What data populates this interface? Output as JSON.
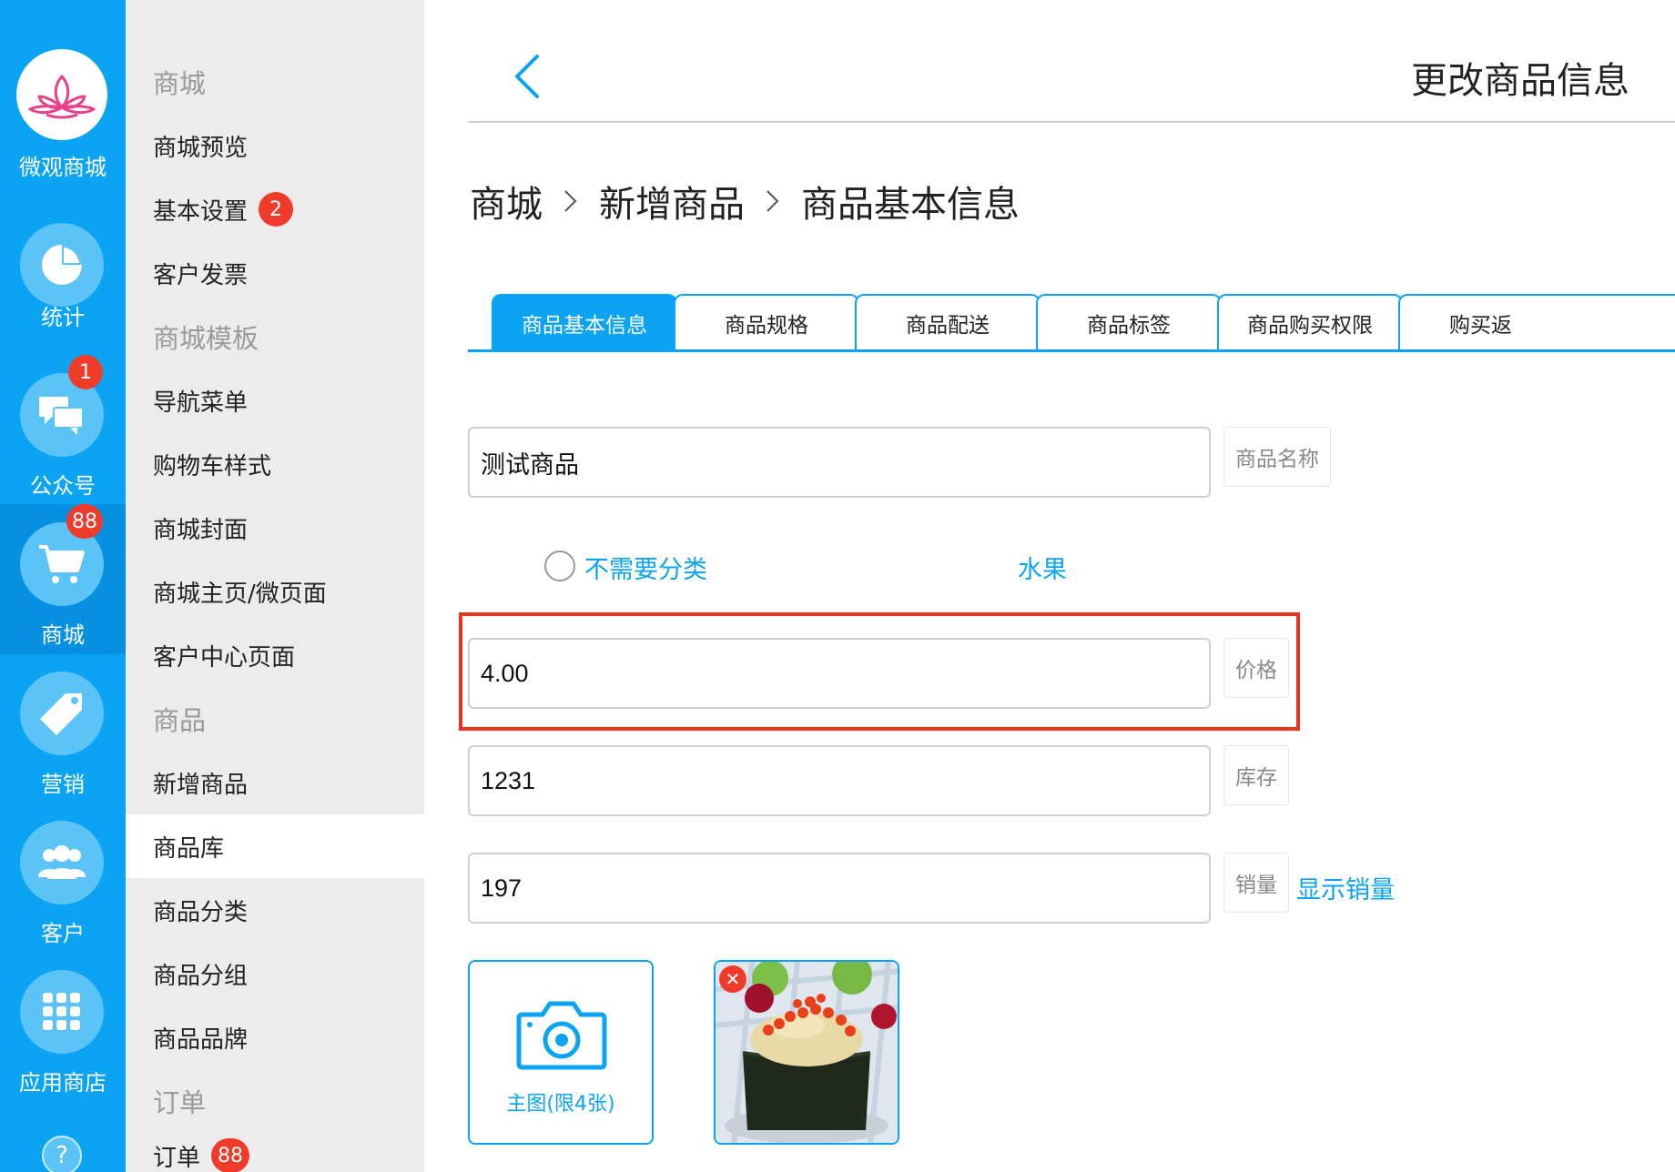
{
  "rail": {
    "logo_label": "微观商城",
    "items": [
      {
        "label": "统计",
        "icon": "pie-chart-icon"
      },
      {
        "label": "公众号",
        "icon": "chat-bubbles-icon",
        "badge": "1"
      },
      {
        "label": "商城",
        "icon": "shopping-cart-icon",
        "badge": "88",
        "active": true
      },
      {
        "label": "营销",
        "icon": "tag-icon"
      },
      {
        "label": "客户",
        "icon": "users-icon"
      },
      {
        "label": "应用商店",
        "icon": "grid-apps-icon"
      }
    ],
    "help": "?"
  },
  "subnav": {
    "items": [
      {
        "label": "商城",
        "type": "header"
      },
      {
        "label": "商城预览"
      },
      {
        "label": "基本设置",
        "badge": "2"
      },
      {
        "label": "客户发票"
      },
      {
        "label": "商城模板",
        "type": "header"
      },
      {
        "label": "导航菜单"
      },
      {
        "label": "购物车样式"
      },
      {
        "label": "商城封面"
      },
      {
        "label": "商城主页/微页面"
      },
      {
        "label": "客户中心页面"
      },
      {
        "label": "商品",
        "type": "header"
      },
      {
        "label": "新增商品"
      },
      {
        "label": "商品库",
        "selected": true
      },
      {
        "label": "商品分类"
      },
      {
        "label": "商品分组"
      },
      {
        "label": "商品品牌"
      },
      {
        "label": "订单",
        "type": "header"
      },
      {
        "label": "订单",
        "badge": "88"
      }
    ]
  },
  "header": {
    "title": "更改商品信息"
  },
  "breadcrumb": [
    "商城",
    "新增商品",
    "商品基本信息"
  ],
  "tabs": [
    "商品基本信息",
    "商品规格",
    "商品配送",
    "商品标签",
    "商品购买权限",
    "购买返"
  ],
  "form": {
    "name": {
      "value": "测试商品",
      "label": "商品名称"
    },
    "category": {
      "radio_label": "不需要分类",
      "selected": "水果"
    },
    "price": {
      "value": "4.00",
      "label": "价格"
    },
    "stock": {
      "value": "1231",
      "label": "库存"
    },
    "sales": {
      "value": "197",
      "label": "销量",
      "toggle_label": "显示销量"
    },
    "images": {
      "upload_label": "主图(限4张)"
    }
  },
  "colors": {
    "primary": "#0aa4f2",
    "badge": "#f03a2a",
    "highlight": "#e8351f"
  }
}
